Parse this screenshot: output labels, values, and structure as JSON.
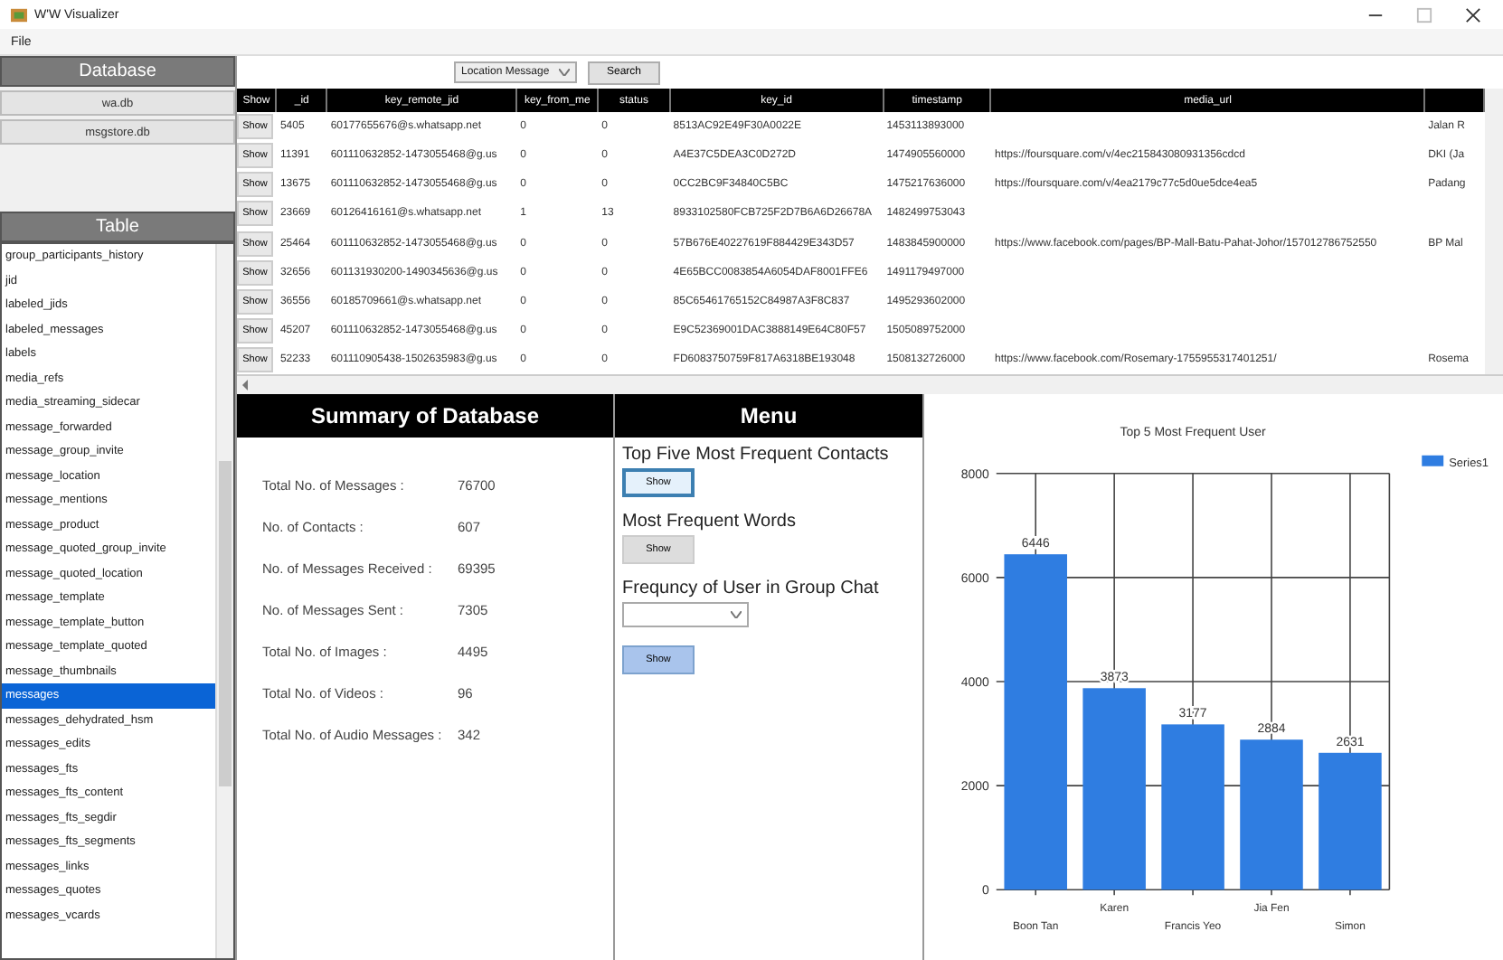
{
  "window": {
    "title": "W'W Visualizer"
  },
  "menu": [
    "File"
  ],
  "sidebar": {
    "database_header": "Database",
    "databases": [
      "wa.db",
      "msgstore.db"
    ],
    "table_header": "Table",
    "tables": [
      {
        "label": "group_participants_history",
        "selected": false
      },
      {
        "label": "jid",
        "selected": false
      },
      {
        "label": "labeled_jids",
        "selected": false
      },
      {
        "label": "labeled_messages",
        "selected": false
      },
      {
        "label": "labels",
        "selected": false
      },
      {
        "label": "media_refs",
        "selected": false
      },
      {
        "label": "media_streaming_sidecar",
        "selected": false
      },
      {
        "label": "message_forwarded",
        "selected": false
      },
      {
        "label": "message_group_invite",
        "selected": false
      },
      {
        "label": "message_location",
        "selected": false
      },
      {
        "label": "message_mentions",
        "selected": false
      },
      {
        "label": "message_product",
        "selected": false
      },
      {
        "label": "message_quoted_group_invite",
        "selected": false
      },
      {
        "label": "message_quoted_location",
        "selected": false
      },
      {
        "label": "message_template",
        "selected": false
      },
      {
        "label": "message_template_button",
        "selected": false
      },
      {
        "label": "message_template_quoted",
        "selected": false
      },
      {
        "label": "message_thumbnails",
        "selected": false
      },
      {
        "label": "messages",
        "selected": true
      },
      {
        "label": "messages_dehydrated_hsm",
        "selected": false
      },
      {
        "label": "messages_edits",
        "selected": false
      },
      {
        "label": "messages_fts",
        "selected": false
      },
      {
        "label": "messages_fts_content",
        "selected": false
      },
      {
        "label": "messages_fts_segdir",
        "selected": false
      },
      {
        "label": "messages_fts_segments",
        "selected": false
      },
      {
        "label": "messages_links",
        "selected": false
      },
      {
        "label": "messages_quotes",
        "selected": false
      },
      {
        "label": "messages_vcards",
        "selected": false
      }
    ]
  },
  "toolbar": {
    "filter": "Location Message",
    "search_button": "Search"
  },
  "table": {
    "columns": [
      "Show",
      "_id",
      "key_remote_jid",
      "key_from_me",
      "status",
      "key_id",
      "timestamp",
      "media_url"
    ],
    "rows": [
      {
        "cells": [
          "Show",
          "5405",
          "60177655676@s.whatsapp.net",
          "0",
          "0",
          "8513AC92E49F30A0022E",
          "1453113893000",
          "",
          "Jalan R"
        ]
      },
      {
        "cells": [
          "Show",
          "11391",
          "601110632852-1473055468@g.us",
          "0",
          "0",
          "A4E37C5DEA3C0D272D",
          "1474905560000",
          "https://foursquare.com/v/4ec215843080931356cdcd",
          "DKI (Ja"
        ]
      },
      {
        "cells": [
          "Show",
          "13675",
          "601110632852-1473055468@g.us",
          "0",
          "0",
          "0CC2BC9F34840C5BC",
          "1475217636000",
          "https://foursquare.com/v/4ea2179c77c5d0ue5dce4ea5",
          "Padang"
        ]
      },
      {
        "cells": [
          "Show",
          "23669",
          "60126416161@s.whatsapp.net",
          "1",
          "13",
          "8933102580FCB725F2D7B6A6D26678A",
          "1482499753043",
          "",
          ""
        ]
      },
      {
        "cells": [
          "Show",
          "25464",
          "601110632852-1473055468@g.us",
          "0",
          "0",
          "57B676E40227619F884429E343D57",
          "1483845900000",
          "https://www.facebook.com/pages/BP-Mall-Batu-Pahat-Johor/157012786752550",
          "BP Mal"
        ]
      },
      {
        "cells": [
          "Show",
          "32656",
          "601131930200-1490345636@g.us",
          "0",
          "0",
          "4E65BCC0083854A6054DAF8001FFE6",
          "1491179497000",
          "",
          ""
        ]
      },
      {
        "cells": [
          "Show",
          "36556",
          "60185709661@s.whatsapp.net",
          "0",
          "0",
          "85C65461765152C84987A3F8C837",
          "1495293602000",
          "",
          ""
        ]
      },
      {
        "cells": [
          "Show",
          "45207",
          "601110632852-1473055468@g.us",
          "0",
          "0",
          "E9C52369001DAC3888149E64C80F57",
          "1505089752000",
          "",
          ""
        ]
      },
      {
        "cells": [
          "Show",
          "52233",
          "601110905438-1502635983@g.us",
          "0",
          "0",
          "FD6083750759F817A6318BE193048",
          "1508132726000",
          "https://www.facebook.com/Rosemary-1755955317401251/",
          "Rosema"
        ]
      }
    ]
  },
  "summary": {
    "title": "Summary of Database",
    "items": [
      {
        "label": "Total No. of Messages :",
        "value": "76700"
      },
      {
        "label": "No. of Contacts :",
        "value": "607"
      },
      {
        "label": "No. of Messages Received :",
        "value": "69395"
      },
      {
        "label": "No. of Messages Sent :",
        "value": "7305"
      },
      {
        "label": "Total No. of Images :",
        "value": "4495"
      },
      {
        "label": "Total No. of Videos :",
        "value": "96"
      },
      {
        "label": "Total No. of Audio Messages :",
        "value": "342"
      }
    ]
  },
  "menu_panel": {
    "title": "Menu",
    "sections": [
      {
        "kind": "button",
        "label": "Top Five Most Frequent Contacts",
        "button": "Show",
        "focused": true,
        "highlighted": false
      },
      {
        "kind": "button",
        "label": "Most Frequent Words",
        "button": "Show",
        "focused": false,
        "highlighted": false
      },
      {
        "kind": "combo",
        "label": "Frequncy of User in Group Chat",
        "button": "Show",
        "focused": false,
        "highlighted": true
      }
    ]
  },
  "chart": {
    "chart_data": {
      "type": "bar",
      "title": "Top 5 Most Frequent User",
      "categories": [
        "Boon Tan",
        "Karen",
        "Francis Yeo",
        "Jia Fen",
        "Simon"
      ],
      "series": [
        {
          "name": "Series1",
          "color": "#2f7de1",
          "values": [
            6446,
            3873,
            3177,
            2884,
            2631
          ]
        }
      ],
      "ylim": [
        0,
        8000
      ],
      "yticks": [
        0,
        2000,
        4000,
        6000,
        8000
      ],
      "data_labels": true,
      "grid": true
    }
  }
}
